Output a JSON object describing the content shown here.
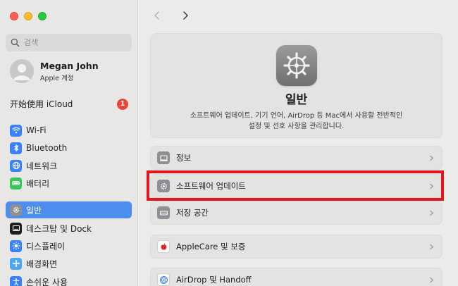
{
  "window": {
    "title": "일반"
  },
  "sidebar": {
    "search_placeholder": "검색",
    "profile": {
      "name": "Megan John",
      "subtitle": "Apple 계정"
    },
    "icloud": {
      "label": "开始使用 iCloud",
      "badge": "1"
    },
    "items": [
      {
        "label": "Wi-Fi",
        "icon": "wifi-icon",
        "color": "#3a82f7"
      },
      {
        "label": "Bluetooth",
        "icon": "bluetooth-icon",
        "color": "#3a82f7"
      },
      {
        "label": "네트워크",
        "icon": "globe-icon",
        "color": "#3a82f7"
      },
      {
        "label": "배터리",
        "icon": "battery-icon",
        "color": "#36c759"
      },
      {
        "label": "일반",
        "icon": "gear-icon",
        "color": "#8e8e93",
        "selected": true
      },
      {
        "label": "데스크탑 및 Dock",
        "icon": "dock-icon",
        "color": "#1d1d1f"
      },
      {
        "label": "디스플레이",
        "icon": "sun-icon",
        "color": "#3a82f7"
      },
      {
        "label": "배경화면",
        "icon": "wallpaper-icon",
        "color": "#4aa8f0"
      },
      {
        "label": "손쉬운 사용",
        "icon": "accessibility-icon",
        "color": "#3a82f7"
      }
    ]
  },
  "main": {
    "header": {
      "title": "일반",
      "desc_line1": "소프트웨어 업데이트, 기기 언어, AirDrop 등 Mac에서 사용할 전반적인",
      "desc_line2": "설정 및 선호 사항을 관리합니다."
    },
    "rows": [
      {
        "label": "정보",
        "icon": "laptop-icon"
      },
      {
        "label": "소프트웨어 업데이트",
        "icon": "gear-icon",
        "highlighted": true
      },
      {
        "label": "저장 공간",
        "icon": "drive-icon"
      },
      {
        "label": "AppleCare 및 보증",
        "icon": "apple-icon"
      },
      {
        "label": "AirDrop 및 Handoff",
        "icon": "airdrop-icon"
      }
    ]
  },
  "colors": {
    "accent": "#4c8ef0",
    "highlight": "#e3161f",
    "badge": "#e8443a"
  }
}
